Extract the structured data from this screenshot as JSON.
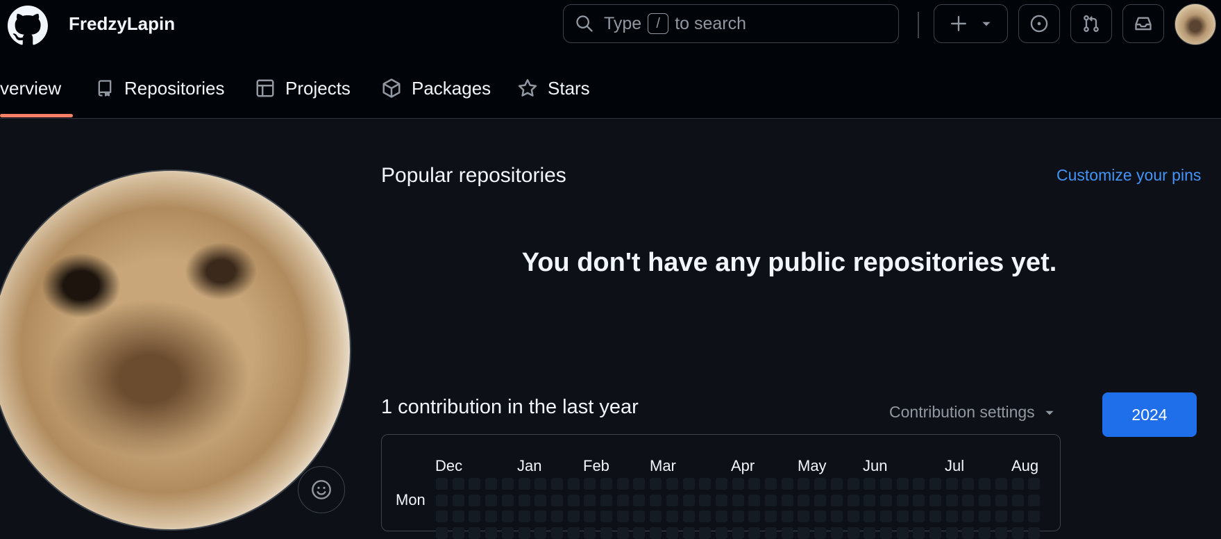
{
  "header": {
    "username": "FredzyLapin",
    "search": {
      "prefix": "Type",
      "key": "/",
      "suffix": "to search"
    }
  },
  "tabs": [
    {
      "label": "verview",
      "active": true
    },
    {
      "label": "Repositories"
    },
    {
      "label": "Projects"
    },
    {
      "label": "Packages"
    },
    {
      "label": "Stars"
    }
  ],
  "popular": {
    "title": "Popular repositories",
    "customize_link": "Customize your pins",
    "empty_message": "You don't have any public repositories yet."
  },
  "contributions": {
    "title": "1 contribution in the last year",
    "settings_label": "Contribution settings",
    "year": "2024",
    "months": [
      "Dec",
      "Jan",
      "Feb",
      "Mar",
      "Apr",
      "May",
      "Jun",
      "Jul",
      "Aug"
    ],
    "day_label": "Mon"
  },
  "colors": {
    "background": "#0d1117",
    "header": "#010409",
    "accent_link": "#4493f8",
    "primary_button": "#1f6feb",
    "tab_underline": "#f78166",
    "empty_cell": "#151b23"
  },
  "icons": {
    "logo": "github-logo-icon",
    "search": "search-icon",
    "create": "plus-icon",
    "issues": "issue-circle-icon",
    "pulls": "pull-request-icon",
    "inbox": "inbox-icon",
    "emoji": "smiley-icon"
  }
}
